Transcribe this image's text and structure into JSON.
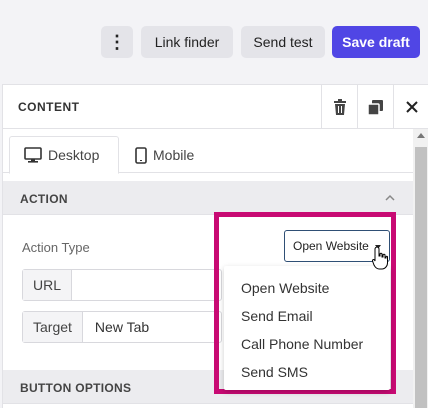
{
  "toolbar": {
    "more_label": "⋮",
    "link_finder": "Link finder",
    "send_test": "Send test",
    "save_draft": "Save draft",
    "accent_color": "#5046e5"
  },
  "panel": {
    "title": "CONTENT",
    "icons": [
      "trash-icon",
      "copy-icon",
      "close-icon"
    ]
  },
  "tabs": [
    {
      "label": "Desktop",
      "icon": "desktop-icon",
      "active": true
    },
    {
      "label": "Mobile",
      "icon": "mobile-icon",
      "active": false
    }
  ],
  "action_section": {
    "title": "ACTION",
    "action_type_label": "Action Type",
    "action_type_value": "Open Website",
    "url_label": "URL",
    "url_value": "",
    "target_label": "Target",
    "target_value": "New Tab"
  },
  "dropdown": {
    "options": [
      "Open Website",
      "Send Email",
      "Call Phone Number",
      "Send SMS"
    ]
  },
  "button_options": {
    "title": "BUTTON OPTIONS"
  },
  "highlight_color": "#c80a73"
}
